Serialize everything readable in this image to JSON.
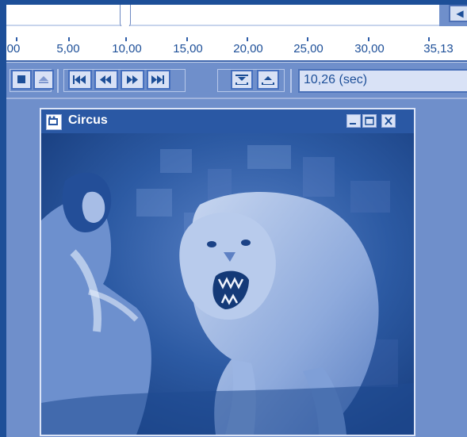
{
  "timeline": {
    "tick_labels": [
      "00",
      "5,00",
      "10,00",
      "15,00",
      "20,00",
      "25,00",
      "30,00",
      "35,13"
    ],
    "current_position_sec": 10.26
  },
  "toolbar": {
    "stop_icon": "stop-icon",
    "eject_icon": "eject-icon",
    "skip_start_icon": "skip-to-start-icon",
    "rewind_icon": "rewind-icon",
    "fast_forward_icon": "fast-forward-icon",
    "skip_end_icon": "skip-to-end-icon",
    "mark_in_icon": "mark-in-icon",
    "mark_out_icon": "mark-out-icon",
    "time_display": "10,26 (sec)"
  },
  "window": {
    "title": "Circus",
    "minimize_icon": "minimize-icon",
    "maximize_icon": "maximize-icon",
    "close_icon": "close-icon"
  },
  "colors": {
    "accent": "#1d4f98",
    "background": "#6f8fcb",
    "panel": "#d9e2f6"
  }
}
